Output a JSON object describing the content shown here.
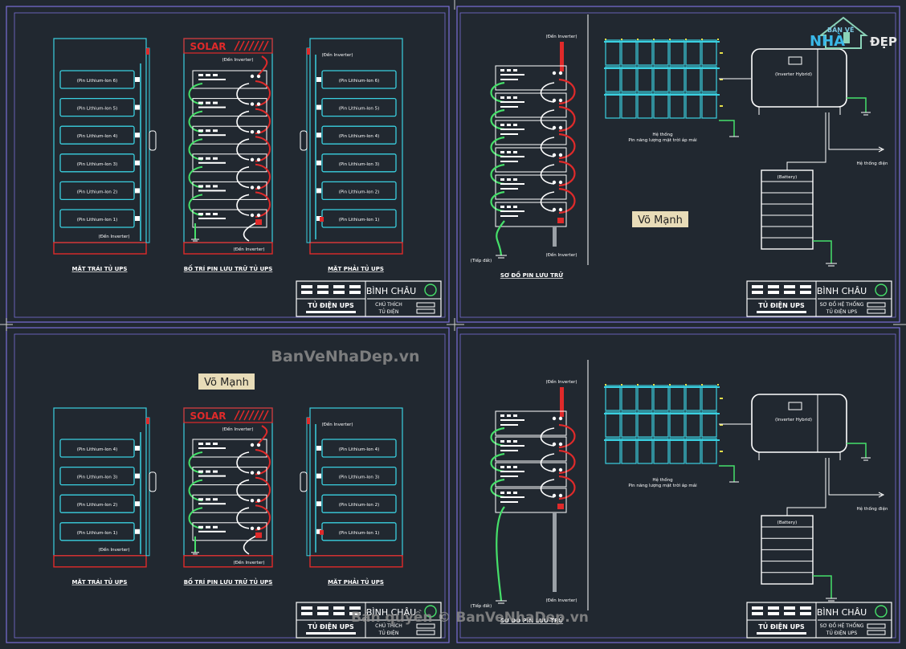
{
  "logo": {
    "top": "BẢN VẼ",
    "nha": "NHÀ",
    "dep": "ĐẸP"
  },
  "watermarks": {
    "center": "BanVeNhaDep.vn",
    "bottom": "Bản quyền © BanVeNhaDep.vn"
  },
  "author": "Võ Mạnh",
  "cabinet": {
    "left_title": "MẶT TRÁI TỦ UPS",
    "center_title": "BỐ TRÍ PIN LƯU TRỮ TỦ UPS",
    "right_title": "MẶT PHẢI TỦ UPS",
    "solar": "SOLAR",
    "to_inverter": "(Đến Inverter)",
    "batteries_6": [
      "(Pin Lithium-Ion 6)",
      "(Pin Lithium-Ion 5)",
      "(Pin Lithium-Ion 4)",
      "(Pin Lithium-Ion 3)",
      "(Pin Lithium-Ion 2)",
      "(Pin Lithium-Ion 1)"
    ],
    "batteries_4": [
      "(Pin Lithium-Ion 4)",
      "(Pin Lithium-Ion 3)",
      "(Pin Lithium-Ion 2)",
      "(Pin Lithium-Ion 1)"
    ]
  },
  "schematic": {
    "title": "SƠ ĐỒ PIN LƯU TRỮ",
    "to_inverter": "(Đến Inverter)",
    "ground": "(Tiếp đất)",
    "inverter": "(Inverter Hybrid)",
    "battery": "(Battery)",
    "system_line1": "Hệ thống",
    "system_line2": "Pin năng lượng mặt trời áp mái",
    "to_grid": "Hệ thống điện"
  },
  "title_block": {
    "company": "BÌNH CHÂU",
    "drawing_ups": "TỦ ĐIỆN UPS",
    "note_line1": "CHÚ THÍCH",
    "note_line2": "TỦ ĐIỆN",
    "system_line1": "SƠ ĐỒ HỆ THỐNG",
    "system_line2": "TỦ ĐIỆN UPS"
  },
  "colors": {
    "background": "#212830",
    "frame": "#7a6fd6",
    "cyan": "#3ad0e0",
    "red": "#e02a2a",
    "green": "#46e06a",
    "white": "#ffffff",
    "label_bg": "#e8dcb8"
  }
}
